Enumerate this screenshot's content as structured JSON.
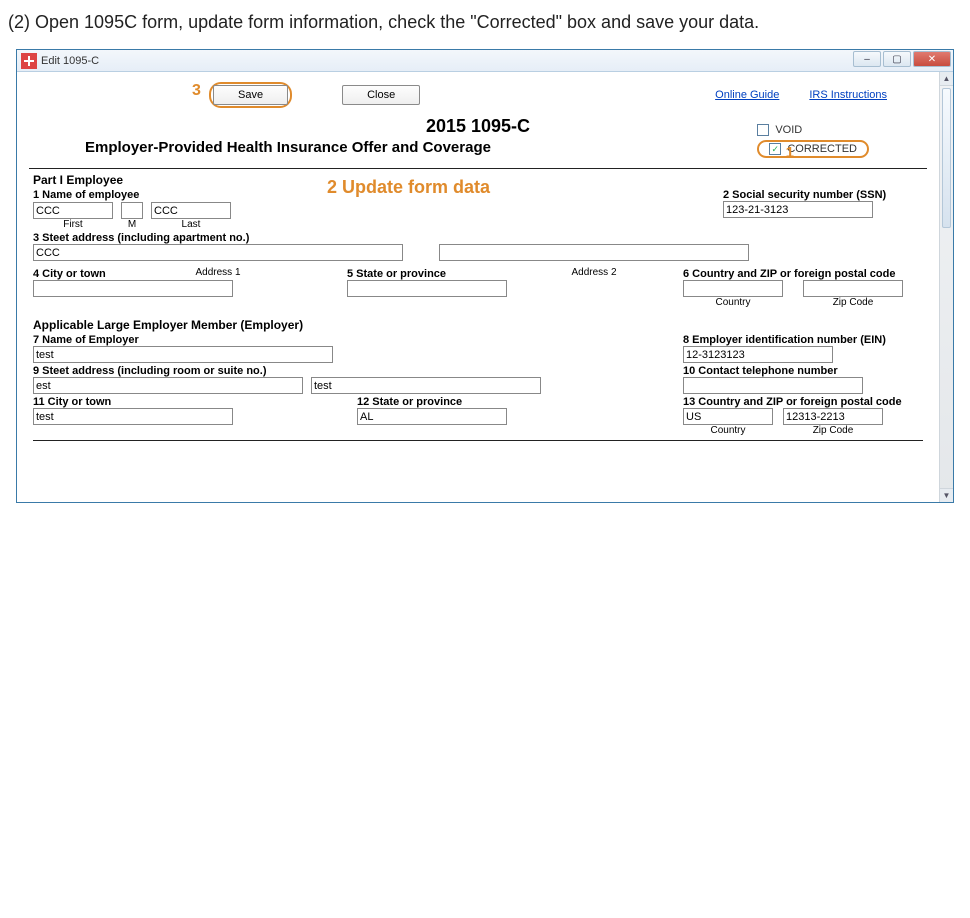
{
  "instruction_text": "(2) Open 1095C form, update form information, check the \"Corrected\" box and save your data.",
  "window": {
    "title": "Edit 1095-C"
  },
  "toolbar": {
    "save_label": "Save",
    "close_label": "Close"
  },
  "links": {
    "online_guide": "Online Guide",
    "irs_instructions": "IRS Instructions"
  },
  "annotations": {
    "n1": "1",
    "n2": "2 Update form data",
    "n3": "3"
  },
  "header": {
    "title": "2015 1095-C",
    "subtitle": "Employer-Provided Health Insurance Offer and Coverage",
    "void_label": "VOID",
    "corrected_label": "CORRECTED",
    "void_checked": false,
    "corrected_checked": true
  },
  "partI": {
    "title": "Part I Employee",
    "f1": {
      "label": "1 Name of employee",
      "first": "CCC",
      "m": "",
      "last": "CCC",
      "first_sub": "First",
      "m_sub": "M",
      "last_sub": "Last"
    },
    "f2": {
      "label": "2 Social security number (SSN)",
      "value": "123-21-3123"
    },
    "f3": {
      "label": "3 Steet address (including apartment no.)",
      "addr1": "CCC",
      "addr2": "",
      "addr1_sub": "Address 1",
      "addr2_sub": "Address 2"
    },
    "f4": {
      "label": "4 City or town",
      "value": ""
    },
    "f5": {
      "label": "5 State or province",
      "value": ""
    },
    "f6": {
      "label": "6 Country and ZIP or foreign postal code",
      "country": "",
      "zip": "",
      "country_sub": "Country",
      "zip_sub": "Zip Code"
    }
  },
  "employer": {
    "title": "Applicable Large Employer Member (Employer)",
    "f7": {
      "label": "7 Name of Employer",
      "value": "test"
    },
    "f8": {
      "label": "8 Employer identification number (EIN)",
      "value": "12-3123123"
    },
    "f9": {
      "label": "9 Steet address (including room or suite no.)",
      "addr1": "est",
      "addr2": "test"
    },
    "f10": {
      "label": "10 Contact telephone number",
      "value": ""
    },
    "f11": {
      "label": "11 City or town",
      "value": "test"
    },
    "f12": {
      "label": "12 State or province",
      "value": "AL"
    },
    "f13": {
      "label": "13 Country and ZIP or foreign postal code",
      "country": "US",
      "zip": "12313-2213",
      "country_sub": "Country",
      "zip_sub": "Zip Code"
    }
  }
}
